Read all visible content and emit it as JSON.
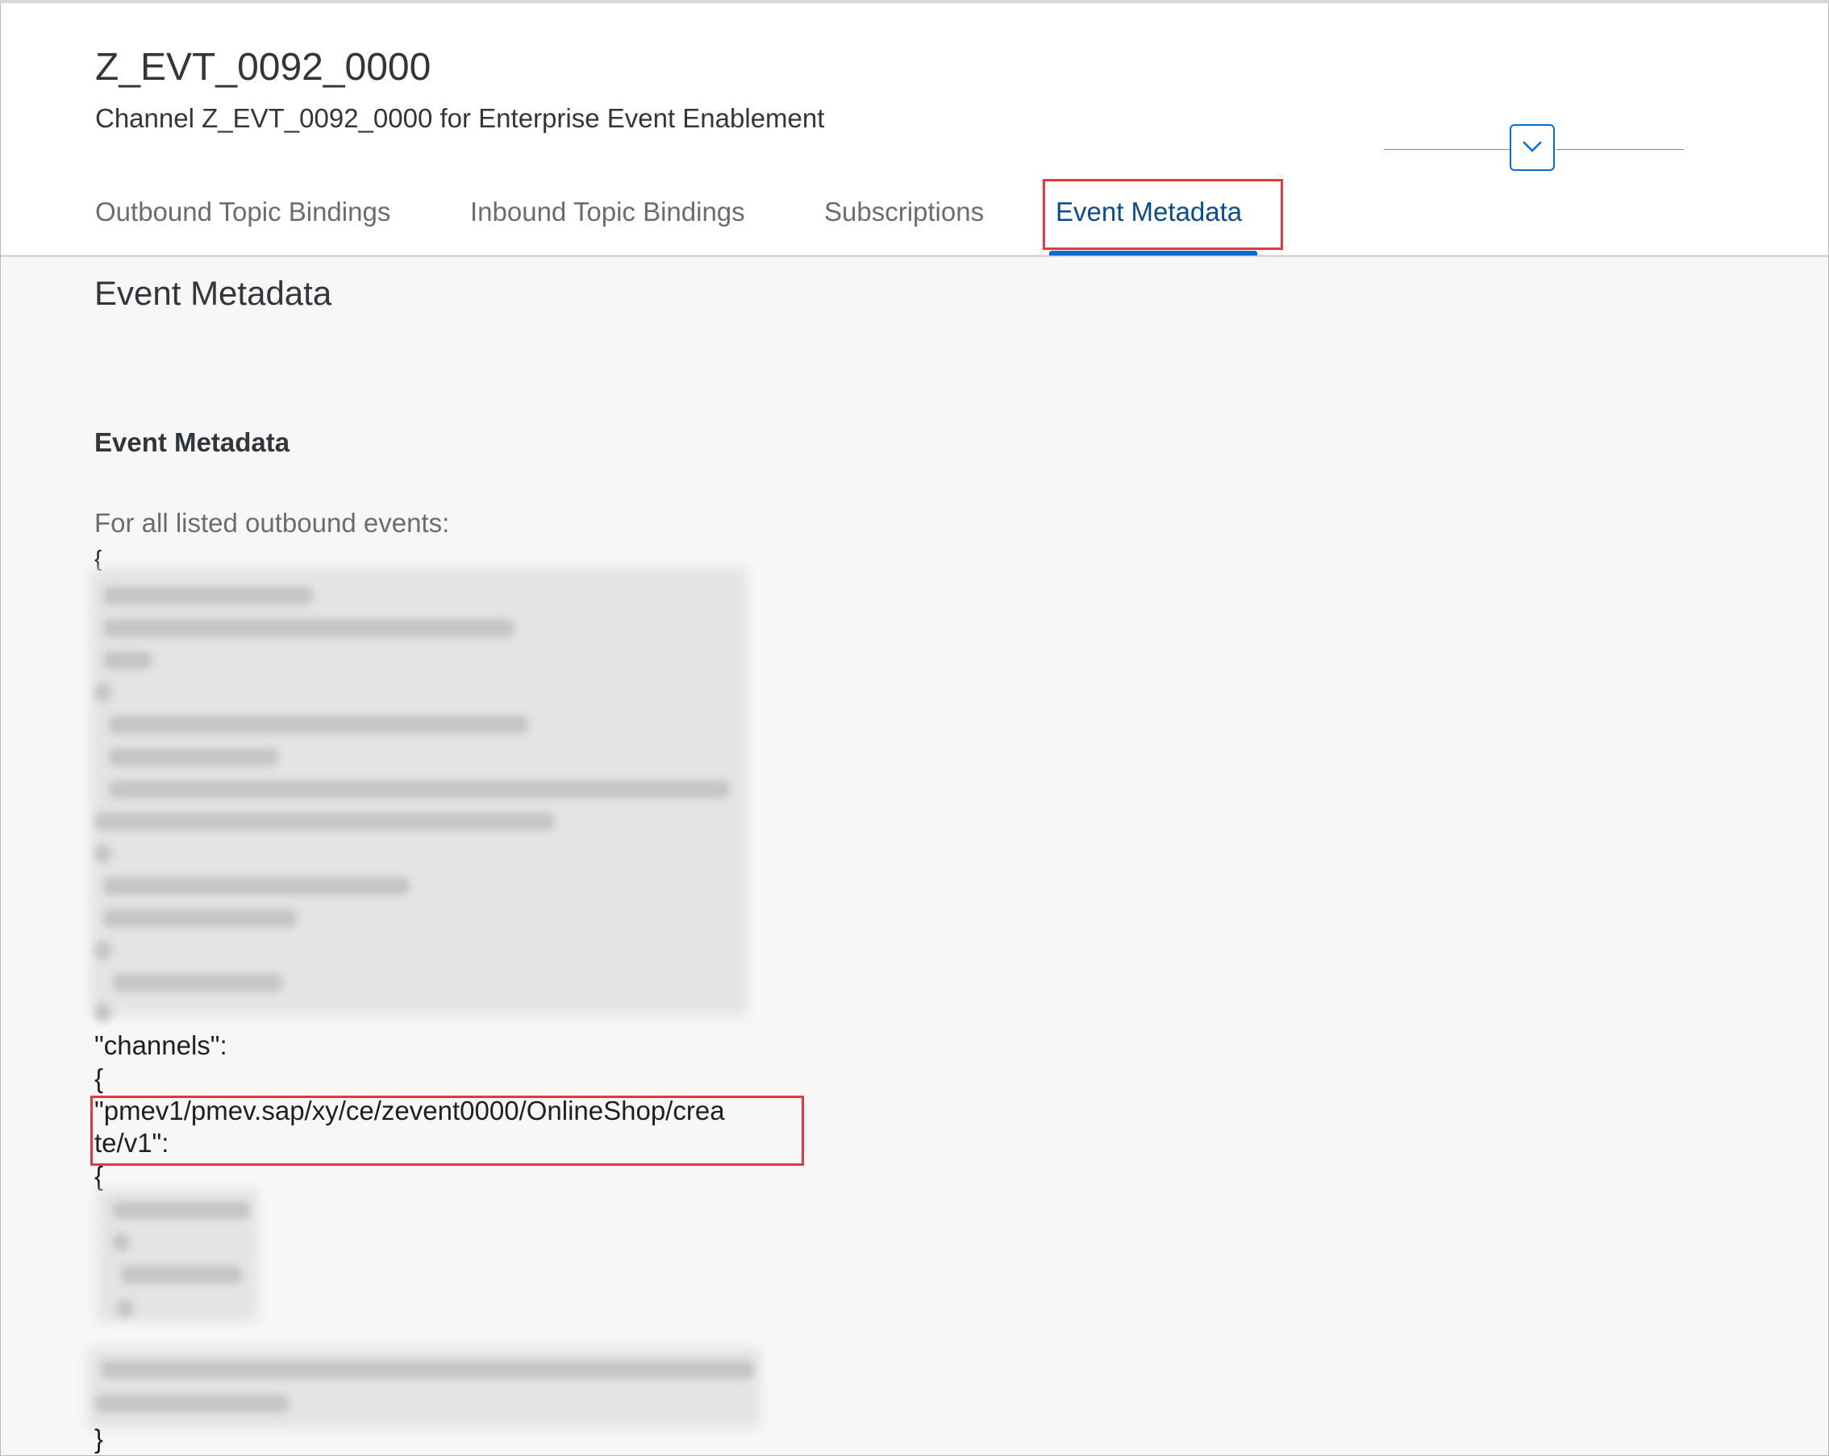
{
  "header": {
    "title": "Z_EVT_0092_0000",
    "subtitle": "Channel Z_EVT_0092_0000 for Enterprise Event Enablement",
    "collapse_icon": "chevron-down-icon"
  },
  "tabs": [
    {
      "label": "Outbound Topic Bindings",
      "active": false
    },
    {
      "label": "Inbound Topic Bindings",
      "active": false
    },
    {
      "label": "Subscriptions",
      "active": false
    },
    {
      "label": "Event Metadata",
      "active": true
    }
  ],
  "section": {
    "title": "Event Metadata",
    "group_title": "Event Metadata",
    "intro": "For all listed outbound events:"
  },
  "code": {
    "open_brace": "{",
    "channels_key": "\"channels\":",
    "channels_open": "{",
    "topic_line1": " \"pmev1/pmev.sap/xy/ce/zevent0000/OnlineShop/crea",
    "topic_line2": "te/v1\":",
    "topic_open": " {",
    "close_brace": "   }"
  },
  "colors": {
    "accent": "#0a6ed1",
    "active_tab": "#0a4d8f",
    "highlight": "#e03a40",
    "background": "#f7f7f7"
  }
}
